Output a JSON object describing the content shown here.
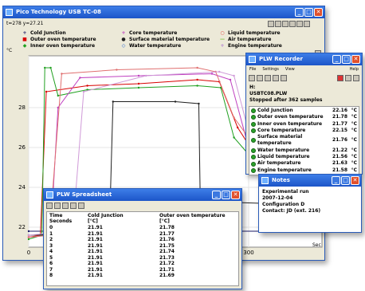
{
  "main": {
    "title": "Pico Technology USB TC-08",
    "cursor": "t=278 y=27.21",
    "y_unit": "°C",
    "x_unit": "Sec",
    "legend": [
      {
        "name": "Cold Junction",
        "color": "#1a1a66",
        "marker": "+"
      },
      {
        "name": "Outer oven temperature",
        "color": "#d80000",
        "marker": "■"
      },
      {
        "name": "Inner oven temperature",
        "color": "#20a020",
        "marker": "◆"
      },
      {
        "name": "Core temperature",
        "color": "#c040c0",
        "marker": "+"
      },
      {
        "name": "Surface material temperature",
        "color": "#202020",
        "marker": "●"
      },
      {
        "name": "Water temperature",
        "color": "#2060d0",
        "marker": "◇"
      },
      {
        "name": "Liquid temperature",
        "color": "#e03030",
        "marker": "○"
      },
      {
        "name": "Air temperature",
        "color": "#80c040",
        "marker": "—"
      },
      {
        "name": "Engine temperature",
        "color": "#b07fd0",
        "marker": "+"
      }
    ]
  },
  "chart_data": {
    "type": "line",
    "ylabel": "°C",
    "xlabel": "Sec",
    "yticks": [
      22,
      24,
      26,
      28
    ],
    "xticks": [
      0,
      300
    ],
    "ylim": [
      21,
      30.6
    ],
    "xlim": [
      0,
      400
    ],
    "grid": true,
    "series": [
      {
        "name": "Cold Junction",
        "color": "#1a1a66",
        "points": [
          [
            0,
            21.8
          ],
          [
            400,
            21.8
          ]
        ]
      },
      {
        "name": "Outer oven temperature",
        "color": "#d80000",
        "points": [
          [
            0,
            21.5
          ],
          [
            16,
            21.6
          ],
          [
            24,
            28.8
          ],
          [
            80,
            29.1
          ],
          [
            150,
            29.2
          ],
          [
            230,
            29.4
          ],
          [
            260,
            29.3
          ],
          [
            285,
            27.0
          ],
          [
            320,
            25.0
          ],
          [
            360,
            24.0
          ],
          [
            400,
            23.6
          ]
        ]
      },
      {
        "name": "Inner oven temperature",
        "color": "#20a020",
        "points": [
          [
            0,
            21.4
          ],
          [
            18,
            21.6
          ],
          [
            22,
            30.0
          ],
          [
            30,
            30.0
          ],
          [
            40,
            28.6
          ],
          [
            80,
            28.9
          ],
          [
            150,
            29.0
          ],
          [
            230,
            29.1
          ],
          [
            262,
            29.0
          ],
          [
            280,
            26.5
          ],
          [
            320,
            24.8
          ],
          [
            360,
            24.0
          ],
          [
            400,
            23.7
          ]
        ]
      },
      {
        "name": "Core temperature",
        "color": "#c040c0",
        "points": [
          [
            0,
            21.5
          ],
          [
            30,
            21.6
          ],
          [
            40,
            28.0
          ],
          [
            70,
            29.5
          ],
          [
            150,
            29.6
          ],
          [
            250,
            29.7
          ],
          [
            275,
            29.4
          ],
          [
            300,
            26.0
          ],
          [
            330,
            24.5
          ],
          [
            400,
            23.8
          ]
        ]
      },
      {
        "name": "Surface material temperature",
        "color": "#202020",
        "points": [
          [
            0,
            21.6
          ],
          [
            110,
            21.7
          ],
          [
            115,
            28.3
          ],
          [
            200,
            28.3
          ],
          [
            232,
            28.2
          ],
          [
            234,
            23.3
          ],
          [
            400,
            23.1
          ]
        ]
      },
      {
        "name": "Liquid temperature",
        "color": "#e07070",
        "points": [
          [
            0,
            21.5
          ],
          [
            28,
            21.6
          ],
          [
            45,
            29.7
          ],
          [
            120,
            29.9
          ],
          [
            230,
            30.0
          ],
          [
            255,
            29.8
          ],
          [
            280,
            27.5
          ],
          [
            330,
            25.0
          ],
          [
            400,
            24.0
          ]
        ]
      },
      {
        "name": "Engine temperature",
        "color": "#d09ad8",
        "points": [
          [
            0,
            21.6
          ],
          [
            60,
            21.8
          ],
          [
            75,
            28.8
          ],
          [
            160,
            29.6
          ],
          [
            260,
            29.8
          ],
          [
            280,
            29.6
          ],
          [
            300,
            26.8
          ],
          [
            340,
            24.8
          ],
          [
            400,
            24.1
          ]
        ]
      }
    ]
  },
  "recorder": {
    "title": "PLW Recorder",
    "menu": [
      "File",
      "Settings",
      "View",
      "Help"
    ],
    "file_label": "H:",
    "file_name": "USBTC08.PLW",
    "status": "Stopped after 362 samples",
    "channels": [
      {
        "name": "Cold Junction",
        "value": "22.16",
        "unit": "°C"
      },
      {
        "name": "Outer oven temperature",
        "value": "21.78",
        "unit": "°C"
      },
      {
        "name": "Inner oven temperature",
        "value": "21.77",
        "unit": "°C"
      },
      {
        "name": "Core temperature",
        "value": "22.15",
        "unit": "°C"
      },
      {
        "name": "Surface material temperature",
        "value": "21.76",
        "unit": "°C"
      },
      {
        "name": "Water temperature",
        "value": "21.22",
        "unit": "°C"
      },
      {
        "name": "Liquid temperature",
        "value": "21.56",
        "unit": "°C"
      },
      {
        "name": "Air temperature",
        "value": "21.63",
        "unit": "°C"
      },
      {
        "name": "Engine temperature",
        "value": "21.58",
        "unit": "°C"
      }
    ]
  },
  "notes": {
    "title": "Notes",
    "lines": [
      "Experimental run",
      "2007-12-04",
      "Configuration D",
      "Contact: JD (ext. 216)"
    ]
  },
  "spreadsheet": {
    "title": "PLW Spreadsheet",
    "col1_header": [
      "Time",
      "Seconds"
    ],
    "col2_header": [
      "Cold Junction",
      "[°C]"
    ],
    "col3_header": [
      "Outer oven temperature",
      "[°C]"
    ],
    "rows": [
      [
        "0",
        "21.91",
        "21.78"
      ],
      [
        "1",
        "21.91",
        "21.77"
      ],
      [
        "2",
        "21.91",
        "21.76"
      ],
      [
        "3",
        "21.91",
        "21.75"
      ],
      [
        "4",
        "21.91",
        "21.74"
      ],
      [
        "5",
        "21.91",
        "21.73"
      ],
      [
        "6",
        "21.91",
        "21.72"
      ],
      [
        "7",
        "21.91",
        "21.71"
      ],
      [
        "8",
        "21.91",
        "21.69"
      ]
    ]
  }
}
